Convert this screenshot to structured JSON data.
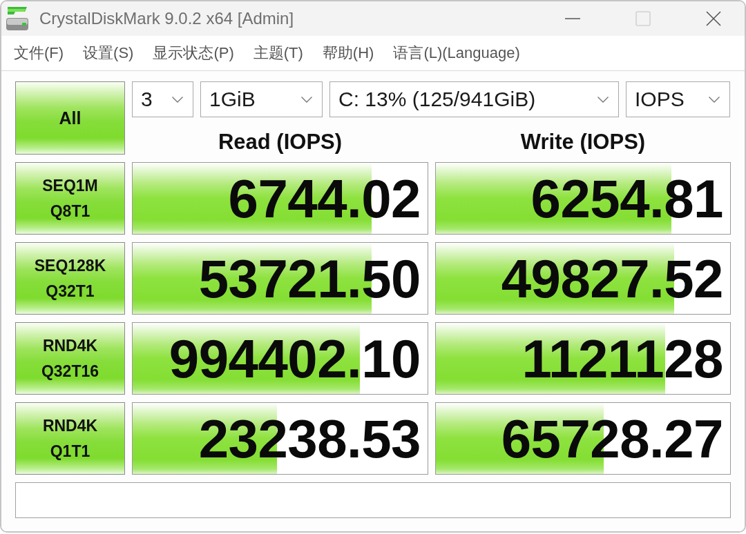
{
  "window": {
    "title": "CrystalDiskMark 9.0.2 x64 [Admin]",
    "controls": [
      {
        "kind": "minimize",
        "disabled": false
      },
      {
        "kind": "maximize",
        "disabled": true
      },
      {
        "kind": "close",
        "disabled": false
      }
    ]
  },
  "menu": [
    "文件(F)",
    "设置(S)",
    "显示状态(P)",
    "主题(T)",
    "帮助(H)",
    "语言(L)(Language)"
  ],
  "all_button": "All",
  "selectors": [
    "3",
    "1GiB",
    "C: 13% (125/941GiB)",
    "IOPS"
  ],
  "columns": [
    "Read (IOPS)",
    "Write (IOPS)"
  ],
  "tests": [
    {
      "name": "SEQ1M",
      "params": "Q8T1",
      "read": {
        "value": "6744.02",
        "level": 0.81
      },
      "write": {
        "value": "6254.81",
        "level": 0.8
      }
    },
    {
      "name": "SEQ128K",
      "params": "Q32T1",
      "read": {
        "value": "53721.50",
        "level": 0.81
      },
      "write": {
        "value": "49827.52",
        "level": 0.81
      }
    },
    {
      "name": "RND4K",
      "params": "Q32T16",
      "read": {
        "value": "994402.10",
        "level": 0.77
      },
      "write": {
        "value": "1121128",
        "level": 0.78
      }
    },
    {
      "name": "RND4K",
      "params": "Q1T1",
      "read": {
        "value": "23238.53",
        "level": 0.49
      },
      "write": {
        "value": "65728.27",
        "level": 0.57
      }
    }
  ]
}
